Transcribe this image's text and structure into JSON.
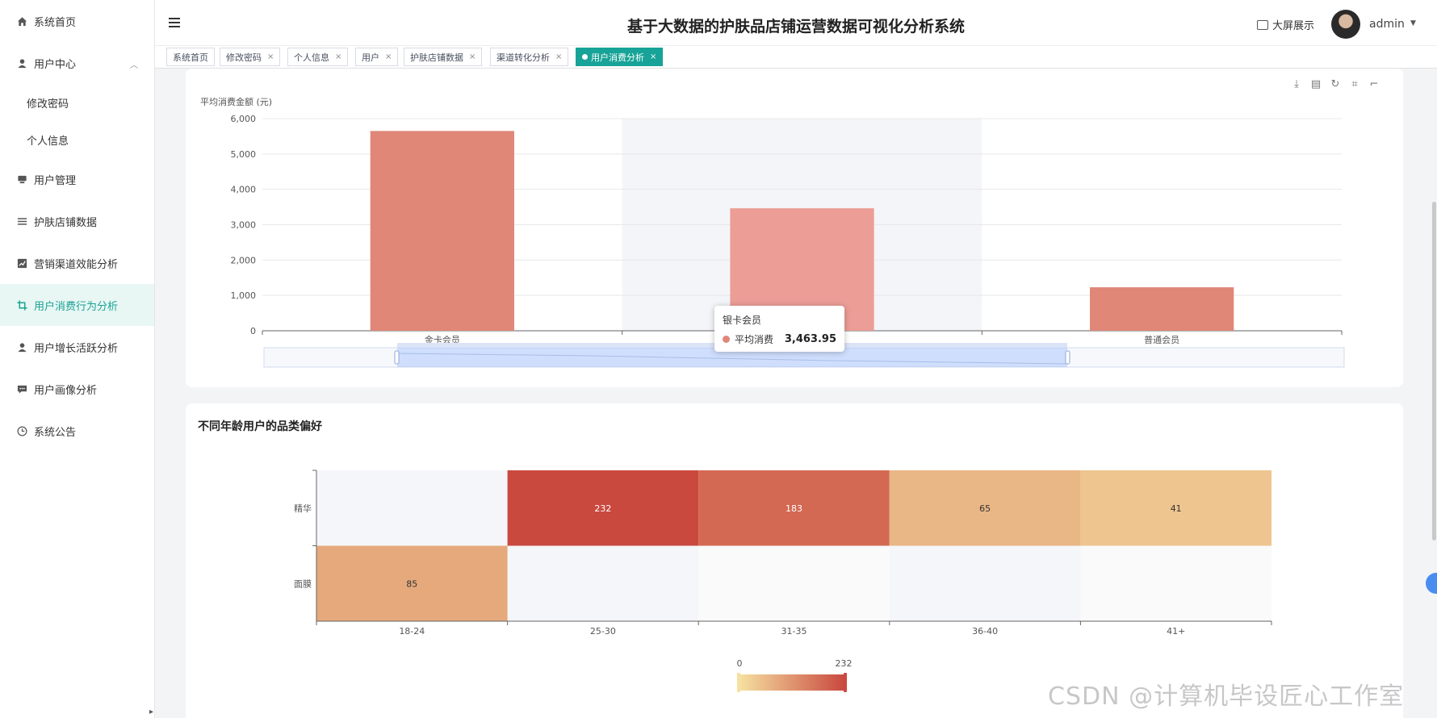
{
  "sidebar": {
    "items": [
      {
        "label": "系统首页",
        "icon": "home-icon"
      },
      {
        "label": "用户中心",
        "icon": "user-icon"
      },
      {
        "label": "用户管理",
        "icon": "monitor-icon"
      },
      {
        "label": "护肤店铺数据",
        "icon": "list-icon"
      },
      {
        "label": "营销渠道效能分析",
        "icon": "chart-icon"
      },
      {
        "label": "用户消费行为分析",
        "icon": "crop-icon"
      },
      {
        "label": "用户增长活跃分析",
        "icon": "user-icon"
      },
      {
        "label": "用户画像分析",
        "icon": "message-icon"
      },
      {
        "label": "系统公告",
        "icon": "clock-icon"
      }
    ],
    "submenu": [
      {
        "label": "修改密码"
      },
      {
        "label": "个人信息"
      }
    ]
  },
  "header": {
    "title": "基于大数据的护肤品店铺运营数据可视化分析系统",
    "bigscreen_label": "大屏展示",
    "user": "admin"
  },
  "tabs": [
    {
      "label": "系统首页"
    },
    {
      "label": "修改密码"
    },
    {
      "label": "个人信息"
    },
    {
      "label": "用户"
    },
    {
      "label": "护肤店铺数据"
    },
    {
      "label": "渠道转化分析"
    },
    {
      "label": "用户消费分析"
    }
  ],
  "bar_chart": {
    "tooltip": {
      "title": "银卡会员",
      "series": "平均消费",
      "value": "3,463.95"
    }
  },
  "heatmap_card": {
    "title": "不同年龄用户的品类偏好"
  },
  "watermark": "CSDN @计算机毕设匠心工作室",
  "chart_data": [
    {
      "type": "bar",
      "ylabel": "平均消费金额 (元)",
      "categories": [
        "金卡会员",
        "银卡会员",
        "普通会员"
      ],
      "values": [
        5650,
        3463.95,
        1230
      ],
      "ylim": [
        0,
        6000
      ],
      "yticks": [
        "0",
        "1,000",
        "2,000",
        "3,000",
        "4,000",
        "5,000",
        "6,000"
      ],
      "colors": [
        "#e08778",
        "#eb9d96",
        "#e08778"
      ],
      "highlighted_category": "银卡会员",
      "grid": true
    },
    {
      "type": "heatmap",
      "title": "不同年龄用户的品类偏好",
      "x_categories": [
        "18-24",
        "25-30",
        "31-35",
        "36-40",
        "41+"
      ],
      "y_categories": [
        "精华",
        "面膜"
      ],
      "cells": [
        {
          "x": "25-30",
          "y": "精华",
          "value": 232
        },
        {
          "x": "31-35",
          "y": "精华",
          "value": 183
        },
        {
          "x": "36-40",
          "y": "精华",
          "value": 65
        },
        {
          "x": "41+",
          "y": "精华",
          "value": 41
        },
        {
          "x": "18-24",
          "y": "面膜",
          "value": 85
        }
      ],
      "visual_map": {
        "min": 0,
        "max": 232,
        "min_label": "0",
        "max_label": "232",
        "colors": [
          "#f6e0a0",
          "#c9493f"
        ]
      }
    }
  ]
}
